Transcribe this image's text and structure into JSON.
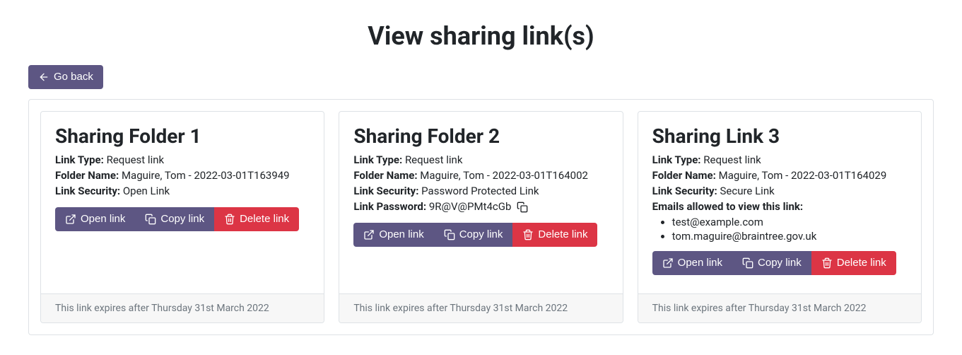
{
  "page": {
    "title": "View sharing link(s)",
    "go_back": "Go back"
  },
  "labels": {
    "link_type": "Link Type:",
    "folder_name": "Folder Name:",
    "link_security": "Link Security:",
    "link_password": "Link Password:",
    "emails_allowed": "Emails allowed to view this link:",
    "open_link": "Open link",
    "copy_link": "Copy link",
    "delete_link": "Delete link"
  },
  "cards": [
    {
      "title": "Sharing Folder 1",
      "link_type": "Request link",
      "folder_name": "Maguire, Tom - 2022-03-01T163949",
      "link_security": "Open Link",
      "expiry": "This link expires after Thursday 31st March 2022"
    },
    {
      "title": "Sharing Folder 2",
      "link_type": "Request link",
      "folder_name": "Maguire, Tom - 2022-03-01T164002",
      "link_security": "Password Protected Link",
      "link_password": "9R@V@PMt4cGb",
      "expiry": "This link expires after Thursday 31st March 2022"
    },
    {
      "title": "Sharing Link 3",
      "link_type": "Request link",
      "folder_name": "Maguire, Tom - 2022-03-01T164029",
      "link_security": "Secure Link",
      "emails": [
        "test@example.com",
        "tom.maguire@braintree.gov.uk"
      ],
      "expiry": "This link expires after Thursday 31st March 2022"
    }
  ]
}
